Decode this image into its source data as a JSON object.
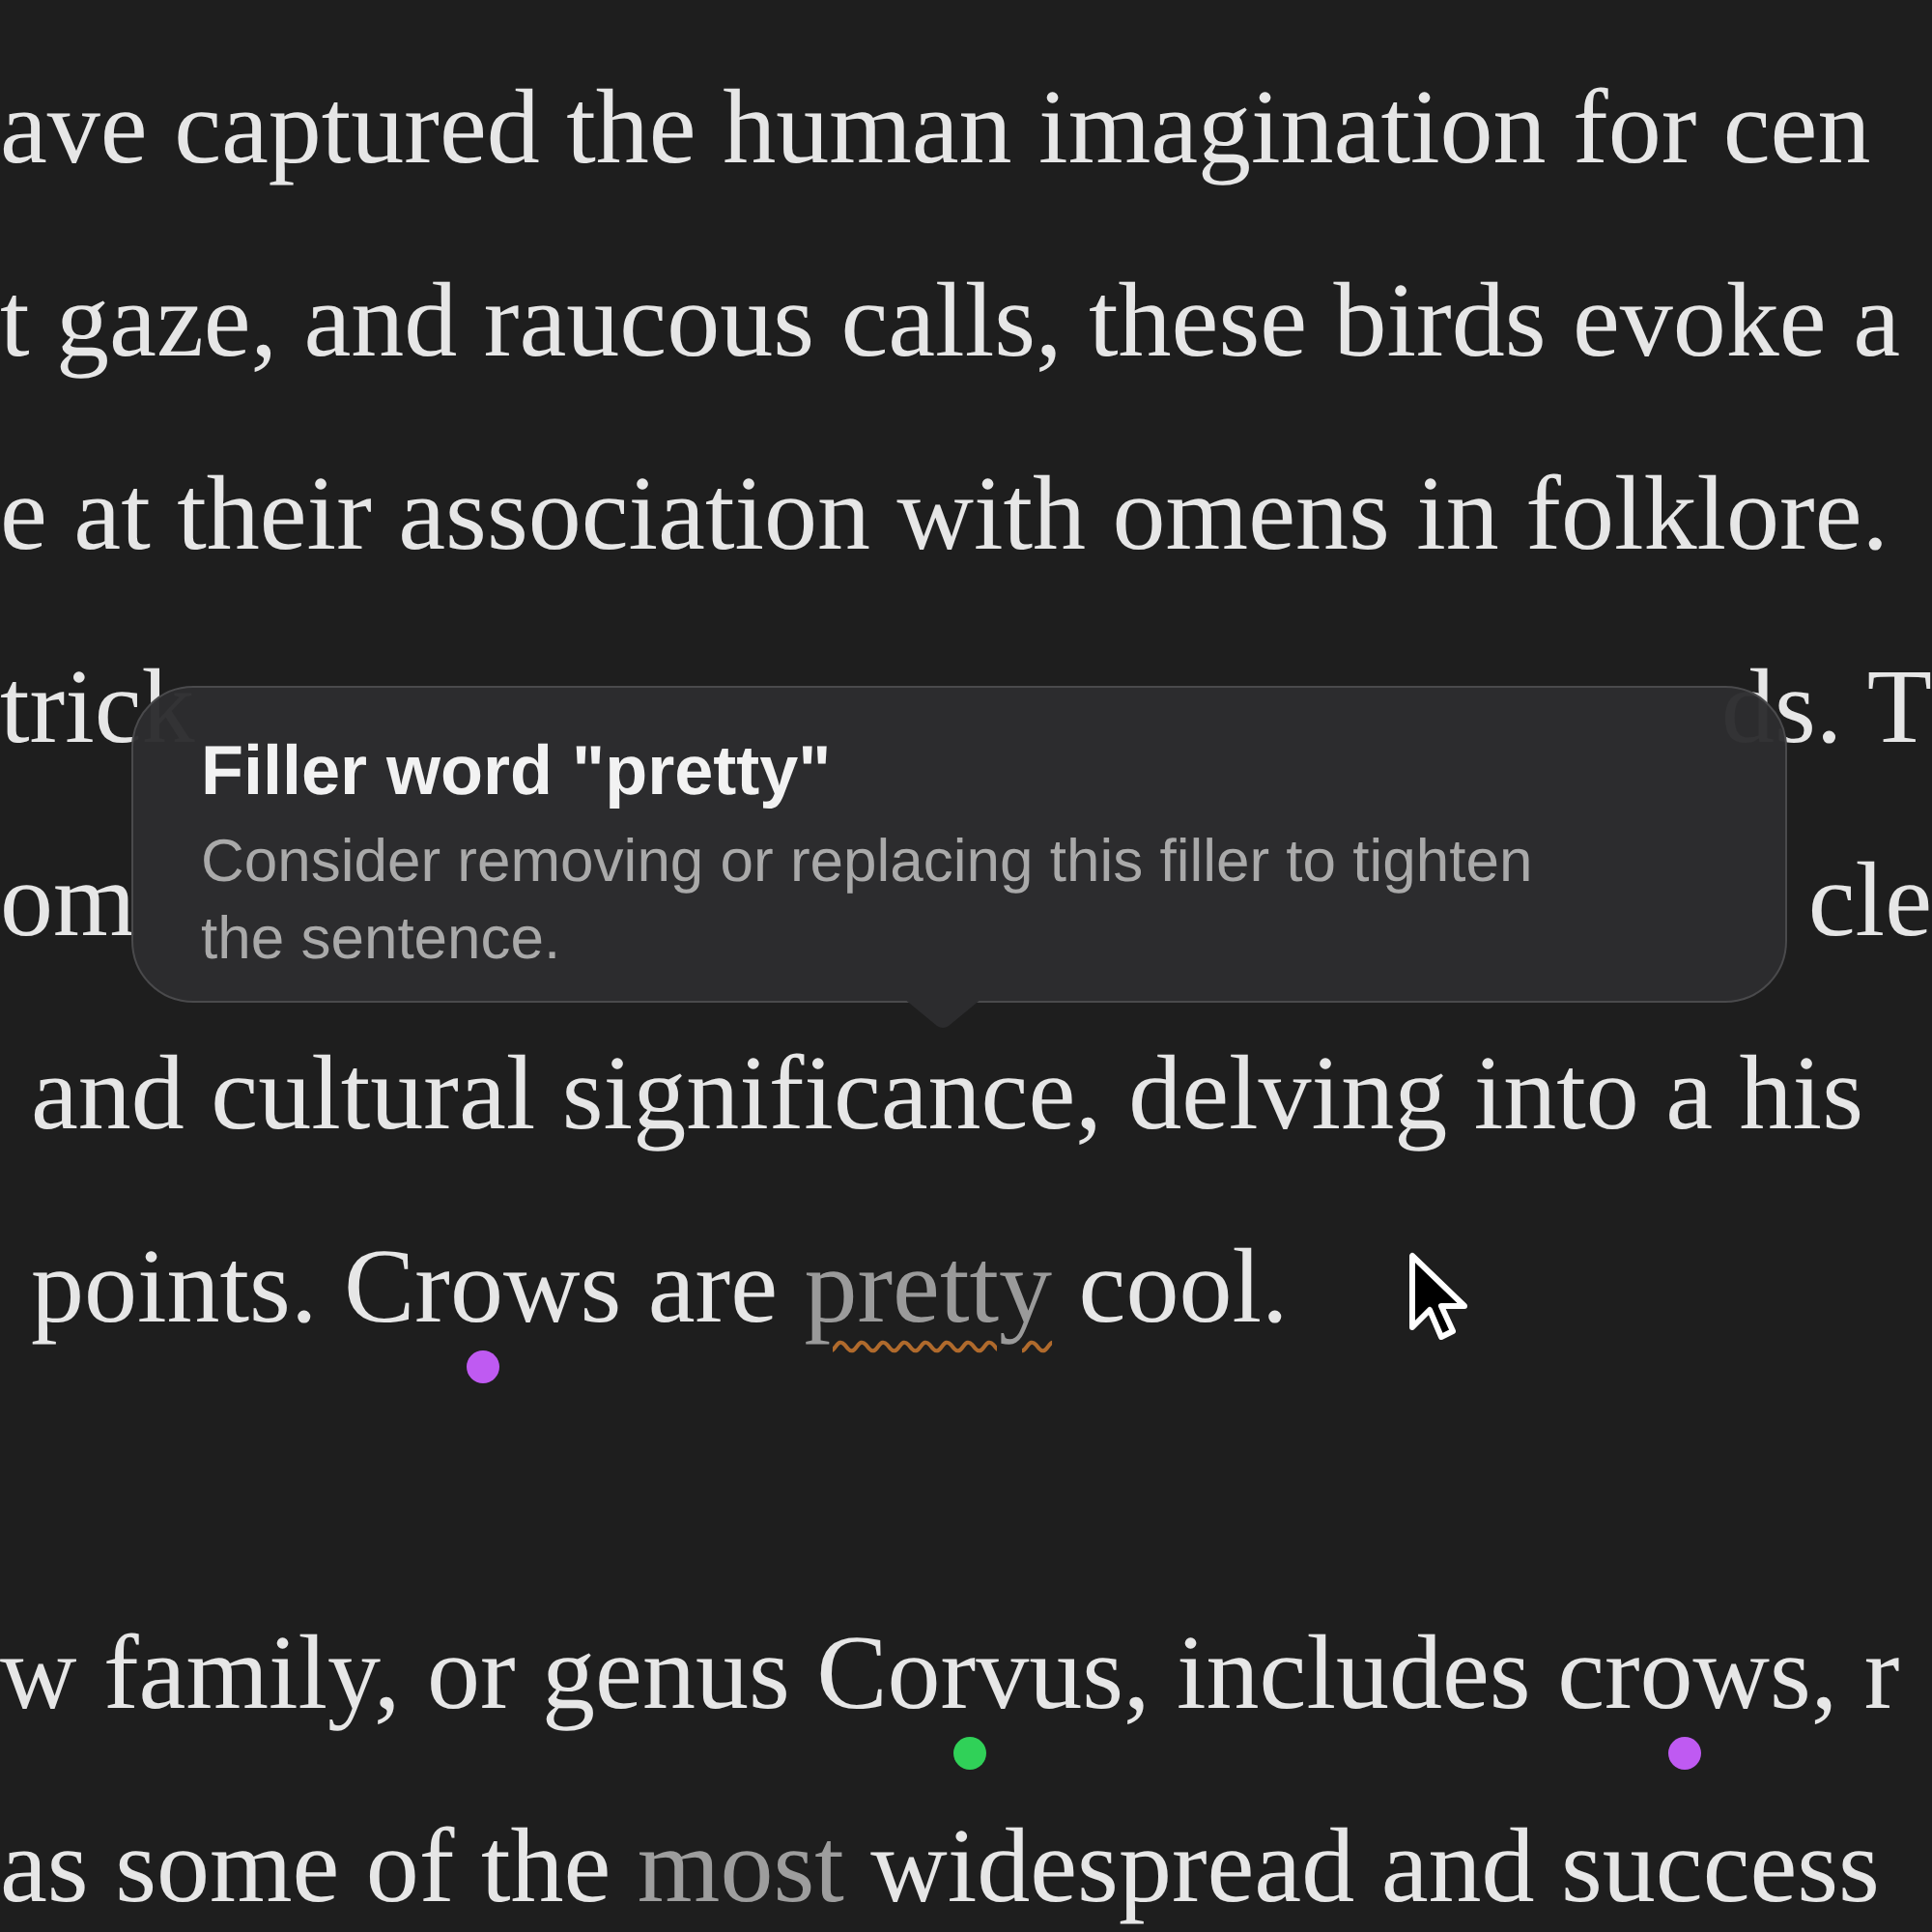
{
  "paragraphs": [
    {
      "lines": [
        {
          "segments": [
            {
              "text": "ave captured the human imagination for cen",
              "kind": "plain"
            }
          ]
        },
        {
          "segments": [
            {
              "text": "t gaze, and raucous calls, these birds evoke a",
              "kind": "plain"
            }
          ]
        },
        {
          "segments": [
            {
              "text": "e at their association with omens in folklore.",
              "kind": "plain"
            }
          ]
        },
        {
          "kind": "split",
          "segments": [
            {
              "text": "trick",
              "kind": "plain"
            },
            {
              "text": "ds. T",
              "kind": "plain"
            }
          ]
        },
        {
          "kind": "split",
          "segments": [
            {
              "text": "om",
              "kind": "plain"
            },
            {
              "text": "cle",
              "kind": "plain"
            }
          ]
        },
        {
          "segments": [
            {
              "text": "and cultural significance, delving into a his",
              "kind": "plain"
            }
          ],
          "indent": true
        },
        {
          "segments": [
            {
              "text": "points. ",
              "kind": "plain"
            },
            {
              "text": "Crows",
              "kind": "plain",
              "marker": {
                "color": "#bf5af2"
              }
            },
            {
              "text": " are ",
              "kind": "plain"
            },
            {
              "text": "pretty",
              "kind": "flagged"
            },
            {
              "text": " cool.",
              "kind": "plain"
            }
          ],
          "indent": true
        }
      ]
    },
    {
      "lines": [
        {
          "segments": [
            {
              "text": "w family, or genus ",
              "kind": "plain"
            },
            {
              "text": "Corvus",
              "kind": "plain",
              "marker": {
                "color": "#30d158"
              }
            },
            {
              "text": ", includes ",
              "kind": "plain"
            },
            {
              "text": "crows",
              "kind": "plain",
              "marker": {
                "color": "#bf5af2"
              }
            },
            {
              "text": ", r",
              "kind": "plain"
            }
          ]
        },
        {
          "segments": [
            {
              "text": "as some of the ",
              "kind": "plain"
            },
            {
              "text": "most",
              "kind": "dimmed"
            },
            {
              "text": " widespread and success",
              "kind": "plain"
            }
          ]
        }
      ]
    }
  ],
  "tooltip": {
    "title": "Filler word \"pretty\"",
    "body": "Consider removing or replacing this filler to tighten the sentence."
  }
}
